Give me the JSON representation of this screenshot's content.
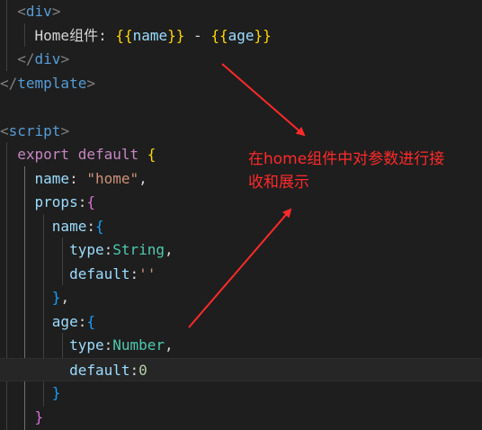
{
  "code_lines": [
    {
      "tokens": [
        {
          "t": "  ",
          "c": "tok-text"
        },
        {
          "t": "<",
          "c": "tok-punc"
        },
        {
          "t": "div",
          "c": "tok-tag"
        },
        {
          "t": ">",
          "c": "tok-punc"
        }
      ]
    },
    {
      "tokens": [
        {
          "t": "    Home组件: ",
          "c": "tok-text"
        },
        {
          "t": "{{",
          "c": "tok-brace"
        },
        {
          "t": "name",
          "c": "tok-var"
        },
        {
          "t": "}}",
          "c": "tok-brace"
        },
        {
          "t": " - ",
          "c": "tok-text"
        },
        {
          "t": "{{",
          "c": "tok-brace"
        },
        {
          "t": "age",
          "c": "tok-var"
        },
        {
          "t": "}}",
          "c": "tok-brace"
        }
      ]
    },
    {
      "tokens": [
        {
          "t": "  ",
          "c": "tok-text"
        },
        {
          "t": "</",
          "c": "tok-punc"
        },
        {
          "t": "div",
          "c": "tok-tag"
        },
        {
          "t": ">",
          "c": "tok-punc"
        }
      ]
    },
    {
      "tokens": [
        {
          "t": "</",
          "c": "tok-punc"
        },
        {
          "t": "template",
          "c": "tok-tag"
        },
        {
          "t": ">",
          "c": "tok-punc"
        }
      ]
    },
    {
      "tokens": []
    },
    {
      "tokens": [
        {
          "t": "<",
          "c": "tok-punc"
        },
        {
          "t": "script",
          "c": "tok-tag"
        },
        {
          "t": ">",
          "c": "tok-punc"
        }
      ]
    },
    {
      "tokens": [
        {
          "t": "  ",
          "c": "tok-text"
        },
        {
          "t": "export",
          "c": "tok-kw"
        },
        {
          "t": " ",
          "c": "tok-text"
        },
        {
          "t": "default",
          "c": "tok-kw"
        },
        {
          "t": " ",
          "c": "tok-text"
        },
        {
          "t": "{",
          "c": "tok-brace"
        }
      ]
    },
    {
      "tokens": [
        {
          "t": "    ",
          "c": "tok-text"
        },
        {
          "t": "name",
          "c": "tok-var"
        },
        {
          "t": ": ",
          "c": "tok-text"
        },
        {
          "t": "\"home\"",
          "c": "tok-str"
        },
        {
          "t": ",",
          "c": "tok-text"
        }
      ]
    },
    {
      "tokens": [
        {
          "t": "    ",
          "c": "tok-text"
        },
        {
          "t": "props",
          "c": "tok-var"
        },
        {
          "t": ":",
          "c": "tok-text"
        },
        {
          "t": "{",
          "c": "tok-brace2"
        }
      ]
    },
    {
      "tokens": [
        {
          "t": "      ",
          "c": "tok-text"
        },
        {
          "t": "name",
          "c": "tok-var"
        },
        {
          "t": ":",
          "c": "tok-text"
        },
        {
          "t": "{",
          "c": "tok-brace3"
        }
      ]
    },
    {
      "tokens": [
        {
          "t": "        ",
          "c": "tok-text"
        },
        {
          "t": "type",
          "c": "tok-var"
        },
        {
          "t": ":",
          "c": "tok-text"
        },
        {
          "t": "String",
          "c": "tok-type"
        },
        {
          "t": ",",
          "c": "tok-text"
        }
      ]
    },
    {
      "tokens": [
        {
          "t": "        ",
          "c": "tok-text"
        },
        {
          "t": "default",
          "c": "tok-var"
        },
        {
          "t": ":",
          "c": "tok-text"
        },
        {
          "t": "''",
          "c": "tok-str"
        }
      ]
    },
    {
      "tokens": [
        {
          "t": "      ",
          "c": "tok-text"
        },
        {
          "t": "}",
          "c": "tok-brace3"
        },
        {
          "t": ",",
          "c": "tok-text"
        }
      ]
    },
    {
      "tokens": [
        {
          "t": "      ",
          "c": "tok-text"
        },
        {
          "t": "age",
          "c": "tok-var"
        },
        {
          "t": ":",
          "c": "tok-text"
        },
        {
          "t": "{",
          "c": "tok-brace3"
        }
      ]
    },
    {
      "tokens": [
        {
          "t": "        ",
          "c": "tok-text"
        },
        {
          "t": "type",
          "c": "tok-var"
        },
        {
          "t": ":",
          "c": "tok-text"
        },
        {
          "t": "Number",
          "c": "tok-type"
        },
        {
          "t": ",",
          "c": "tok-text"
        }
      ]
    },
    {
      "tokens": [
        {
          "t": "        ",
          "c": "tok-text"
        },
        {
          "t": "default",
          "c": "tok-var"
        },
        {
          "t": ":",
          "c": "tok-text"
        },
        {
          "t": "0",
          "c": "tok-num"
        }
      ],
      "current": true
    },
    {
      "tokens": [
        {
          "t": "      ",
          "c": "tok-text"
        },
        {
          "t": "}",
          "c": "tok-brace3"
        }
      ]
    },
    {
      "tokens": [
        {
          "t": "    ",
          "c": "tok-text"
        },
        {
          "t": "}",
          "c": "tok-brace2"
        }
      ]
    }
  ],
  "annotation": {
    "text_line1": "在home组件中对参数进行接",
    "text_line2": "收和展示",
    "color": "#ff2a2a"
  }
}
